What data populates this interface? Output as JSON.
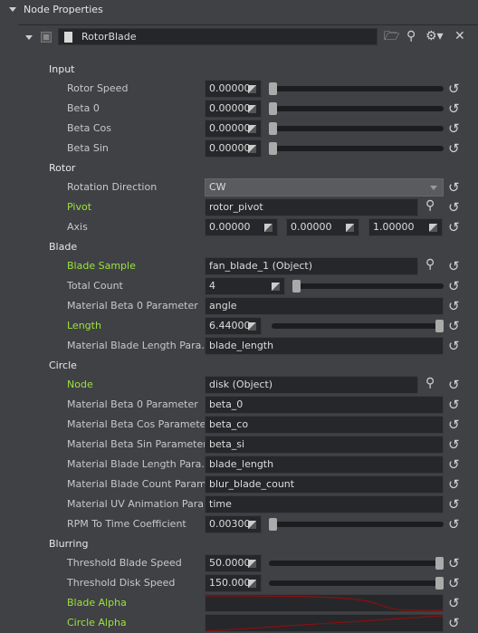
{
  "panel": {
    "title": "Node Properties"
  },
  "node": {
    "name": "RotorBlade"
  },
  "colors": {
    "accent_label": "#9be33b",
    "curve": "#8b0f0f"
  },
  "sections": [
    {
      "title": "Input",
      "rows": [
        {
          "label": "Rotor Speed",
          "type": "num_slider",
          "value": "0.00000",
          "slider": 0
        },
        {
          "label": "Beta 0",
          "type": "num_slider",
          "value": "0.00000",
          "slider": 0
        },
        {
          "label": "Beta Cos",
          "type": "num_slider",
          "value": "0.00000",
          "slider": 0
        },
        {
          "label": "Beta Sin",
          "type": "num_slider",
          "value": "0.00000",
          "slider": 0
        }
      ]
    },
    {
      "title": "Rotor",
      "rows": [
        {
          "label": "Rotation Direction",
          "type": "combo",
          "value": "CW"
        },
        {
          "label": "Pivot",
          "type": "ref",
          "value": "rotor_pivot",
          "green": true
        },
        {
          "label": "Axis",
          "type": "vec3",
          "values": [
            "0.00000",
            "0.00000",
            "1.00000"
          ]
        }
      ]
    },
    {
      "title": "Blade",
      "rows": [
        {
          "label": "Blade Sample",
          "type": "ref",
          "value": "fan_blade_1 (Object)",
          "green": true
        },
        {
          "label": "Total Count",
          "type": "int_slider",
          "value": "4",
          "slider": 0
        },
        {
          "label": "Material Beta 0 Parameter",
          "type": "text",
          "value": "angle"
        },
        {
          "label": "Length",
          "type": "num_slider",
          "value": "6.44000",
          "slider": 1,
          "green": true
        },
        {
          "label": "Material Blade Length Para...",
          "type": "text",
          "value": "blade_length"
        }
      ]
    },
    {
      "title": "Circle",
      "rows": [
        {
          "label": "Node",
          "type": "ref",
          "value": "disk (Object)",
          "green": true
        },
        {
          "label": "Material Beta 0 Parameter",
          "type": "text",
          "value": "beta_0"
        },
        {
          "label": "Material Beta Cos Parameter",
          "type": "text",
          "value": "beta_co"
        },
        {
          "label": "Material Beta Sin Parameter",
          "type": "text",
          "value": "beta_si"
        },
        {
          "label": "Material Blade Length Para...",
          "type": "text",
          "value": "blade_length"
        },
        {
          "label": "Material Blade Count Param...",
          "type": "text",
          "value": "blur_blade_count"
        },
        {
          "label": "Material UV Animation Para...",
          "type": "text",
          "value": "time"
        },
        {
          "label": "RPM To Time Coefficient",
          "type": "num_slider",
          "value": "0.00300",
          "slider": 0
        }
      ]
    },
    {
      "title": "Blurring",
      "rows": [
        {
          "label": "Threshold Blade Speed",
          "type": "num_slider",
          "value": "50.0000",
          "slider": 1
        },
        {
          "label": "Threshold Disk Speed",
          "type": "num_slider",
          "value": "150.000",
          "slider": 1
        },
        {
          "label": "Blade Alpha",
          "type": "curve",
          "curve": "falling",
          "green": true
        },
        {
          "label": "Circle Alpha",
          "type": "curve",
          "curve": "rising",
          "green": true
        }
      ]
    }
  ]
}
